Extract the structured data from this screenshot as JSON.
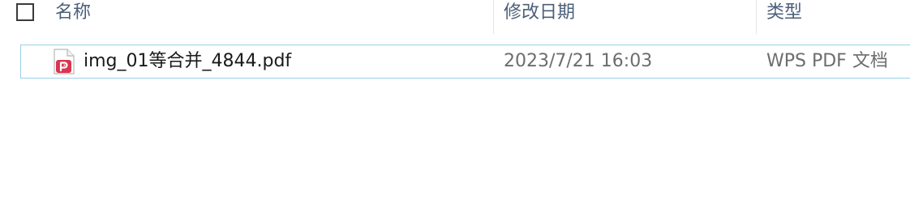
{
  "columns": {
    "name": "名称",
    "date_modified": "修改日期",
    "type": "类型"
  },
  "files": [
    {
      "name": "img_01等合并_4844.pdf",
      "date_modified": "2023/7/21 16:03",
      "type": "WPS PDF 文档",
      "icon": "wps-pdf-icon"
    }
  ],
  "colors": {
    "header_text": "#4c607a",
    "row_border": "#99d1e5",
    "pdf_icon_red": "#d93550"
  }
}
